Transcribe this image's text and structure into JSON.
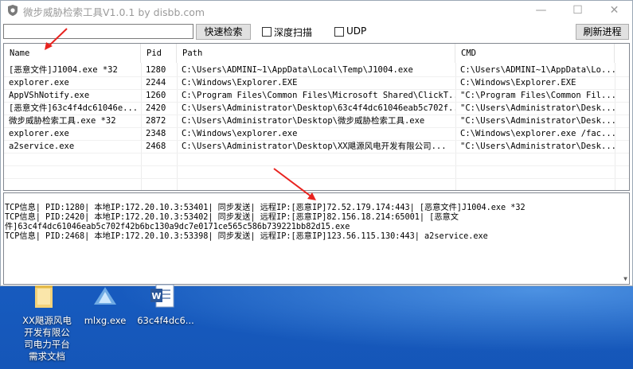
{
  "window": {
    "title": "微步威胁检索工具V1.0.1 by disbb.com",
    "minimize_glyph": "—",
    "maximize_glyph": "☐",
    "close_glyph": "✕"
  },
  "toolbar": {
    "search_value": "",
    "search_button": "快速检索",
    "deep_scan_label": "深度扫描",
    "udp_label": "UDP",
    "refresh_button": "刷新进程"
  },
  "columns": [
    "Name",
    "Pid",
    "Path",
    "CMD"
  ],
  "rows": [
    {
      "name": "[恶意文件]J1004.exe *32",
      "pid": "1280",
      "path": "C:\\Users\\ADMINI~1\\AppData\\Local\\Temp\\J1004.exe",
      "cmd": "C:\\Users\\ADMINI~1\\AppData\\Lo..."
    },
    {
      "name": "explorer.exe",
      "pid": "2244",
      "path": "C:\\Windows\\Explorer.EXE",
      "cmd": "C:\\Windows\\Explorer.EXE"
    },
    {
      "name": "AppVShNotify.exe",
      "pid": "1260",
      "path": "C:\\Program Files\\Common Files\\Microsoft Shared\\ClickT...",
      "cmd": "\"C:\\Program Files\\Common Fil..."
    },
    {
      "name": "[恶意文件]63c4f4dc61046e...",
      "pid": "2420",
      "path": "C:\\Users\\Administrator\\Desktop\\63c4f4dc61046eab5c702f...",
      "cmd": "\"C:\\Users\\Administrator\\Desk..."
    },
    {
      "name": "微步威胁检索工具.exe *32",
      "pid": "2872",
      "path": "C:\\Users\\Administrator\\Desktop\\微步威胁检索工具.exe",
      "cmd": "\"C:\\Users\\Administrator\\Desk..."
    },
    {
      "name": "explorer.exe",
      "pid": "2348",
      "path": "C:\\Windows\\explorer.exe",
      "cmd": "C:\\Windows\\explorer.exe /fac..."
    },
    {
      "name": "a2service.exe",
      "pid": "2468",
      "path": "C:\\Users\\Administrator\\Desktop\\XX飓源风电开发有限公司...",
      "cmd": "\"C:\\Users\\Administrator\\Desk..."
    }
  ],
  "log_lines": [
    "TCP信息| PID:1280| 本地IP:172.20.10.3:53401| 同步发送| 远程IP:[恶意IP]72.52.179.174:443| [恶意文件]J1004.exe *32",
    "TCP信息| PID:2420| 本地IP:172.20.10.3:53402| 同步发送| 远程IP:[恶意IP]82.156.18.214:65001| [恶意文",
    "件]63c4f4dc61046eab5c702f42b6bc130a9dc7e0171ce565c586b739221bb82d15.exe",
    "TCP信息| PID:2468| 本地IP:172.20.10.3:53398| 同步发送| 远程IP:[恶意IP]123.56.115.130:443| a2service.exe"
  ],
  "desktop_icons": [
    {
      "label": "XX飓源风电开发有限公司电力平台需求文档",
      "lines": [
        "XX飓源风电",
        "开发有限公",
        "司电力平台",
        "需求文档"
      ],
      "icon": "folder-icon"
    },
    {
      "label": "mlxg.exe",
      "lines": [
        "mlxg.exe"
      ],
      "icon": "exe-icon"
    },
    {
      "label": "63c4f4dc6...",
      "lines": [
        "63c4f4dc6..."
      ],
      "icon": "word-doc-icon"
    }
  ],
  "colors": {
    "annotation_arrow": "#e8231f",
    "desktop_bg": "#1a62c9",
    "word_blue": "#2b579a"
  }
}
